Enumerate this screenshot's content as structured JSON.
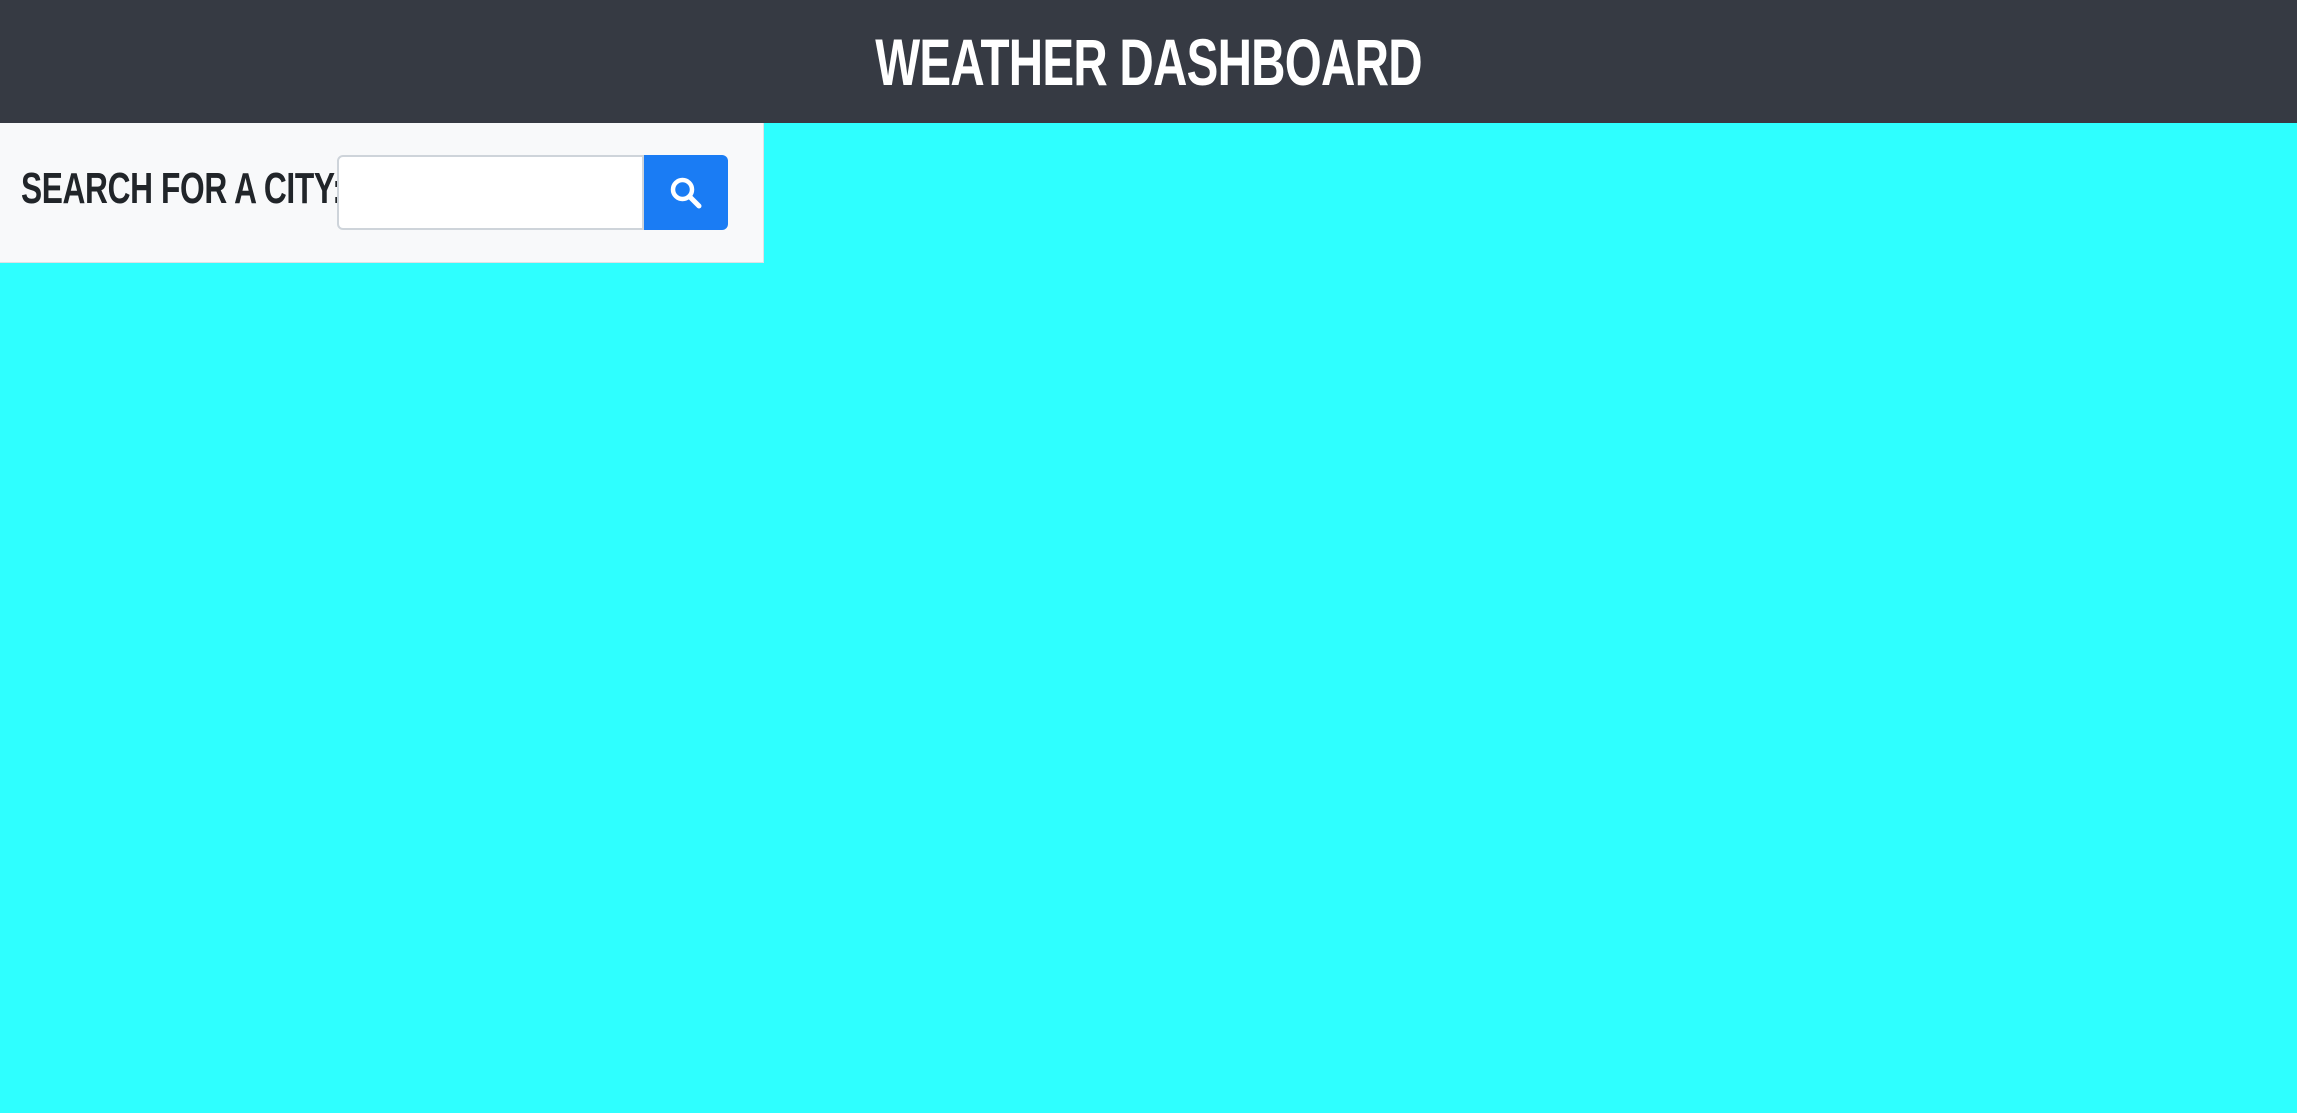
{
  "header": {
    "title": "Weather Dashboard"
  },
  "search": {
    "label": "Search for a city:",
    "input_value": "",
    "input_placeholder": "",
    "button_icon": "search-icon"
  },
  "colors": {
    "header_bg": "#363a43",
    "panel_bg": "#f8f9fa",
    "content_bg": "#2effff",
    "button_bg": "#1a7cf4"
  }
}
